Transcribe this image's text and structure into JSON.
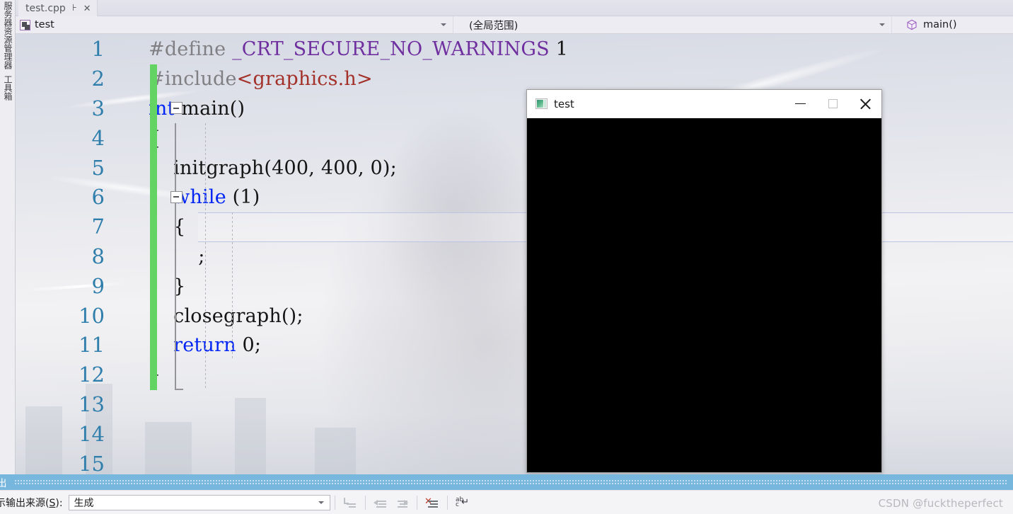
{
  "left_dock": {
    "items": [
      {
        "label": "服务器资源管理器",
        "name": "server-explorer"
      },
      {
        "label": "工具箱",
        "name": "toolbox"
      }
    ]
  },
  "tab_bar": {
    "active_tab": "test.cpp",
    "pin_icon": "⊦",
    "close_icon": "✕"
  },
  "nav_bar": {
    "project": "test",
    "project_icon": "project-icon",
    "scope": "(全局范围)",
    "function": "main()",
    "function_icon": "cube-icon",
    "dropdown_icon": "chevron-down-icon"
  },
  "editor": {
    "lines": [
      {
        "no": "1",
        "changed": false,
        "fold": "none",
        "tokens": [
          {
            "t": "#define ",
            "c": "pp"
          },
          {
            "t": "_CRT_SECURE_NO_WARNINGS",
            "c": "macro"
          },
          {
            "t": " 1",
            "c": "plain"
          }
        ]
      },
      {
        "no": "2",
        "changed": true,
        "fold": "none",
        "tokens": [
          {
            "t": "#include",
            "c": "pp"
          },
          {
            "t": "<graphics.h>",
            "c": "hdr"
          }
        ]
      },
      {
        "no": "3",
        "changed": true,
        "fold": "box",
        "tokens": [
          {
            "t": "int",
            "c": "kw"
          },
          {
            "t": " main()",
            "c": "plain"
          }
        ]
      },
      {
        "no": "4",
        "changed": true,
        "fold": "line",
        "tokens": [
          {
            "t": "{",
            "c": "plain"
          }
        ],
        "indent": 1
      },
      {
        "no": "5",
        "changed": true,
        "fold": "line",
        "tokens": [
          {
            "t": "    initgraph(400, 400, 0);",
            "c": "plain"
          }
        ],
        "indent": 1
      },
      {
        "no": "6",
        "changed": true,
        "fold": "box2",
        "tokens": [
          {
            "t": "    ",
            "c": "plain"
          },
          {
            "t": "while",
            "c": "kw"
          },
          {
            "t": " (1)",
            "c": "plain"
          }
        ],
        "indent": 1
      },
      {
        "no": "7",
        "changed": true,
        "fold": "line",
        "current": true,
        "tokens": [
          {
            "t": "    {",
            "c": "plain"
          }
        ],
        "indent": 2
      },
      {
        "no": "8",
        "changed": true,
        "fold": "line",
        "tokens": [
          {
            "t": "        ;",
            "c": "plain"
          }
        ],
        "indent": 2
      },
      {
        "no": "9",
        "changed": true,
        "fold": "line",
        "tokens": [
          {
            "t": "    }",
            "c": "plain"
          }
        ],
        "indent": 2
      },
      {
        "no": "10",
        "changed": true,
        "fold": "line",
        "tokens": [
          {
            "t": "    closegraph();",
            "c": "plain"
          }
        ],
        "indent": 2
      },
      {
        "no": "11",
        "changed": true,
        "fold": "line",
        "tokens": [
          {
            "t": "    ",
            "c": "plain"
          },
          {
            "t": "return",
            "c": "kw"
          },
          {
            "t": " 0;",
            "c": "plain"
          }
        ],
        "indent": 2
      },
      {
        "no": "12",
        "changed": true,
        "fold": "tail",
        "tokens": [
          {
            "t": "}",
            "c": "plain"
          }
        ],
        "indent": 1
      },
      {
        "no": "13",
        "changed": false,
        "fold": "none",
        "tokens": []
      },
      {
        "no": "14",
        "changed": false,
        "fold": "none",
        "tokens": []
      },
      {
        "no": "15",
        "changed": false,
        "fold": "none",
        "tokens": []
      }
    ]
  },
  "popup_window": {
    "title": "test",
    "app_icon": "graphics-window-icon",
    "minimize_label": "—",
    "maximize_label": "▢",
    "close_label": "✕",
    "canvas_color": "#000000"
  },
  "output_pane": {
    "header_title": "出",
    "header_color": "#78b7dd",
    "source_label_prefix": "示输出来源(",
    "source_label_accel": "S",
    "source_label_suffix": "): ",
    "source_value": "生成",
    "dropdown_icon": "chevron-down-icon",
    "buttons": [
      {
        "name": "go-to-message-icon",
        "label": "转到消息源"
      },
      {
        "name": "previous-message-icon",
        "label": "上一条消息"
      },
      {
        "name": "next-message-icon",
        "label": "下一条消息"
      },
      {
        "name": "clear-all-icon",
        "label": "全部清除",
        "badge": "✕"
      },
      {
        "name": "toggle-word-wrap-icon",
        "label": "切换自动换行"
      }
    ]
  },
  "watermark": "CSDN @fucktheperfect",
  "colors": {
    "keyword": "#0025f5",
    "preprocessor": "#808084",
    "macro": "#6f2f9f",
    "header_string": "#a33129",
    "line_number": "#2f7eab",
    "change_bar": "#63d463",
    "output_header": "#78b7dd"
  }
}
